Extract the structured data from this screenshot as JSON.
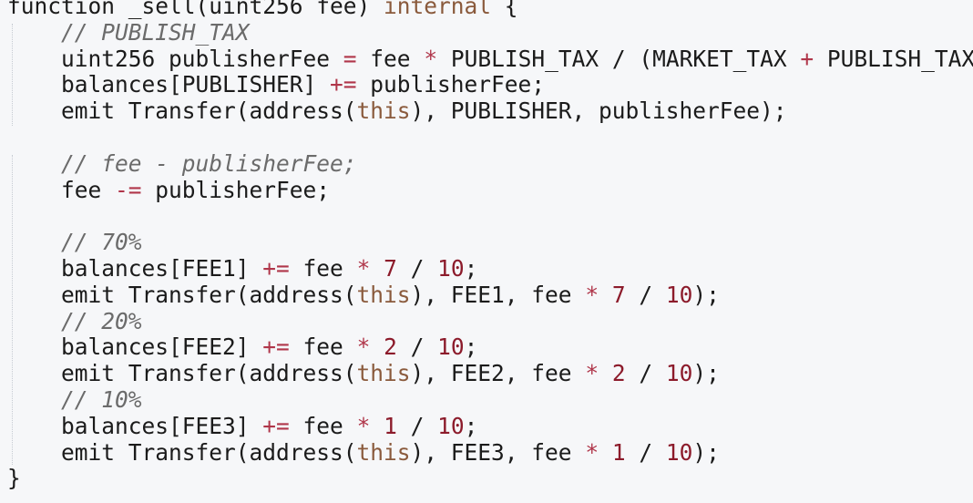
{
  "colors": {
    "background": "#f6f7f9",
    "text": "#1b1b1b",
    "keyword": "#8a5a3c",
    "number": "#8c1b2b",
    "operator": "#b0364a",
    "comment": "#6b6b6b"
  },
  "code": {
    "lines": [
      {
        "indent": "",
        "tokens": [
          {
            "t": "function _sell(uint256 fee) ",
            "c": "plain"
          },
          {
            "t": "internal",
            "c": "kw"
          },
          {
            "t": " {",
            "c": "plain"
          }
        ]
      },
      {
        "indent": "    ",
        "tokens": [
          {
            "t": "// PUBLISH_TAX",
            "c": "comment"
          }
        ]
      },
      {
        "indent": "    ",
        "tokens": [
          {
            "t": "uint256 publisherFee ",
            "c": "plain"
          },
          {
            "t": "=",
            "c": "op"
          },
          {
            "t": " fee ",
            "c": "plain"
          },
          {
            "t": "*",
            "c": "op"
          },
          {
            "t": " PUBLISH_TAX / (MARKET_TAX ",
            "c": "plain"
          },
          {
            "t": "+",
            "c": "op"
          },
          {
            "t": " PUBLISH_TAX);",
            "c": "plain"
          }
        ]
      },
      {
        "indent": "    ",
        "tokens": [
          {
            "t": "balances[PUBLISHER] ",
            "c": "plain"
          },
          {
            "t": "+=",
            "c": "op"
          },
          {
            "t": " publisherFee;",
            "c": "plain"
          }
        ]
      },
      {
        "indent": "    ",
        "tokens": [
          {
            "t": "emit Transfer(address(",
            "c": "plain"
          },
          {
            "t": "this",
            "c": "kw"
          },
          {
            "t": "), PUBLISHER, publisherFee);",
            "c": "plain"
          }
        ]
      },
      {
        "indent": "",
        "tokens": []
      },
      {
        "indent": "    ",
        "tokens": [
          {
            "t": "// fee - publisherFee;",
            "c": "comment"
          }
        ]
      },
      {
        "indent": "    ",
        "tokens": [
          {
            "t": "fee ",
            "c": "plain"
          },
          {
            "t": "-=",
            "c": "op"
          },
          {
            "t": " publisherFee;",
            "c": "plain"
          }
        ]
      },
      {
        "indent": "",
        "tokens": []
      },
      {
        "indent": "    ",
        "tokens": [
          {
            "t": "// 70%",
            "c": "comment"
          }
        ]
      },
      {
        "indent": "    ",
        "tokens": [
          {
            "t": "balances[FEE1] ",
            "c": "plain"
          },
          {
            "t": "+=",
            "c": "op"
          },
          {
            "t": " fee ",
            "c": "plain"
          },
          {
            "t": "*",
            "c": "op"
          },
          {
            "t": " ",
            "c": "plain"
          },
          {
            "t": "7",
            "c": "num"
          },
          {
            "t": " / ",
            "c": "plain"
          },
          {
            "t": "10",
            "c": "num"
          },
          {
            "t": ";",
            "c": "plain"
          }
        ]
      },
      {
        "indent": "    ",
        "tokens": [
          {
            "t": "emit Transfer(address(",
            "c": "plain"
          },
          {
            "t": "this",
            "c": "kw"
          },
          {
            "t": "), FEE1, fee ",
            "c": "plain"
          },
          {
            "t": "*",
            "c": "op"
          },
          {
            "t": " ",
            "c": "plain"
          },
          {
            "t": "7",
            "c": "num"
          },
          {
            "t": " / ",
            "c": "plain"
          },
          {
            "t": "10",
            "c": "num"
          },
          {
            "t": ");",
            "c": "plain"
          }
        ]
      },
      {
        "indent": "    ",
        "tokens": [
          {
            "t": "// 20%",
            "c": "comment"
          }
        ]
      },
      {
        "indent": "    ",
        "tokens": [
          {
            "t": "balances[FEE2] ",
            "c": "plain"
          },
          {
            "t": "+=",
            "c": "op"
          },
          {
            "t": " fee ",
            "c": "plain"
          },
          {
            "t": "*",
            "c": "op"
          },
          {
            "t": " ",
            "c": "plain"
          },
          {
            "t": "2",
            "c": "num"
          },
          {
            "t": " / ",
            "c": "plain"
          },
          {
            "t": "10",
            "c": "num"
          },
          {
            "t": ";",
            "c": "plain"
          }
        ]
      },
      {
        "indent": "    ",
        "tokens": [
          {
            "t": "emit Transfer(address(",
            "c": "plain"
          },
          {
            "t": "this",
            "c": "kw"
          },
          {
            "t": "), FEE2, fee ",
            "c": "plain"
          },
          {
            "t": "*",
            "c": "op"
          },
          {
            "t": " ",
            "c": "plain"
          },
          {
            "t": "2",
            "c": "num"
          },
          {
            "t": " / ",
            "c": "plain"
          },
          {
            "t": "10",
            "c": "num"
          },
          {
            "t": ");",
            "c": "plain"
          }
        ]
      },
      {
        "indent": "    ",
        "tokens": [
          {
            "t": "// 10%",
            "c": "comment"
          }
        ]
      },
      {
        "indent": "    ",
        "tokens": [
          {
            "t": "balances[FEE3] ",
            "c": "plain"
          },
          {
            "t": "+=",
            "c": "op"
          },
          {
            "t": " fee ",
            "c": "plain"
          },
          {
            "t": "*",
            "c": "op"
          },
          {
            "t": " ",
            "c": "plain"
          },
          {
            "t": "1",
            "c": "num"
          },
          {
            "t": " / ",
            "c": "plain"
          },
          {
            "t": "10",
            "c": "num"
          },
          {
            "t": ";",
            "c": "plain"
          }
        ]
      },
      {
        "indent": "    ",
        "tokens": [
          {
            "t": "emit Transfer(address(",
            "c": "plain"
          },
          {
            "t": "this",
            "c": "kw"
          },
          {
            "t": "), FEE3, fee ",
            "c": "plain"
          },
          {
            "t": "*",
            "c": "op"
          },
          {
            "t": " ",
            "c": "plain"
          },
          {
            "t": "1",
            "c": "num"
          },
          {
            "t": " / ",
            "c": "plain"
          },
          {
            "t": "10",
            "c": "num"
          },
          {
            "t": ");",
            "c": "plain"
          }
        ]
      },
      {
        "indent": "",
        "tokens": [
          {
            "t": "}",
            "c": "plain"
          }
        ]
      }
    ]
  }
}
